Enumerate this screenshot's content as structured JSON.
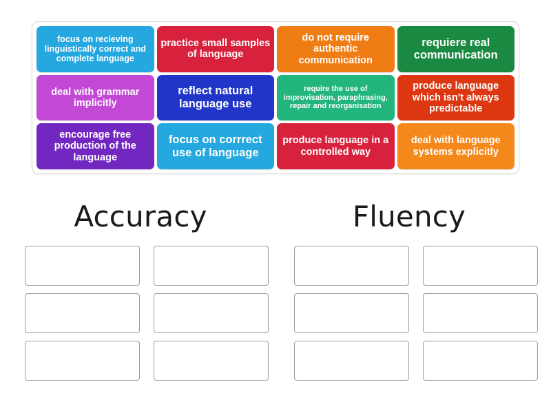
{
  "activity": {
    "type": "group-sort",
    "tray": {
      "tiles": [
        {
          "text": "focus on recieving linguistically correct and complete language",
          "color": "#25A8E0",
          "size": "sm"
        },
        {
          "text": "practice small samples of language",
          "color": "#D8213C",
          "size": "md"
        },
        {
          "text": "do not require authentic communication",
          "color": "#F07D14",
          "size": "md"
        },
        {
          "text": "requiere real communication",
          "color": "#1A8942",
          "size": "lg"
        },
        {
          "text": "deal with grammar implicitly",
          "color": "#C348D6",
          "size": "md"
        },
        {
          "text": "reflect natural language use",
          "color": "#2136C9",
          "size": "lg"
        },
        {
          "text": "require the use of improvisation, paraphrasing, repair and reorganisation",
          "color": "#22B57C",
          "size": "xs"
        },
        {
          "text": "produce language which isn't always predictable",
          "color": "#DC3711",
          "size": "md"
        },
        {
          "text": "encourage free production of the language",
          "color": "#7327C1",
          "size": "md"
        },
        {
          "text": "focus on corrrect use of language",
          "color": "#25A8E0",
          "size": "lg"
        },
        {
          "text": "produce language in a controlled way",
          "color": "#D8213C",
          "size": "md"
        },
        {
          "text": "deal with language systems explicitly",
          "color": "#F5881A",
          "size": "md"
        }
      ]
    },
    "categories": [
      {
        "id": "accuracy",
        "label": "Accuracy",
        "dropzones": [
          {
            "value": ""
          },
          {
            "value": ""
          },
          {
            "value": ""
          },
          {
            "value": ""
          },
          {
            "value": ""
          },
          {
            "value": ""
          }
        ]
      },
      {
        "id": "fluency",
        "label": "Fluency",
        "dropzones": [
          {
            "value": ""
          },
          {
            "value": ""
          },
          {
            "value": ""
          },
          {
            "value": ""
          },
          {
            "value": ""
          },
          {
            "value": ""
          }
        ]
      }
    ]
  }
}
